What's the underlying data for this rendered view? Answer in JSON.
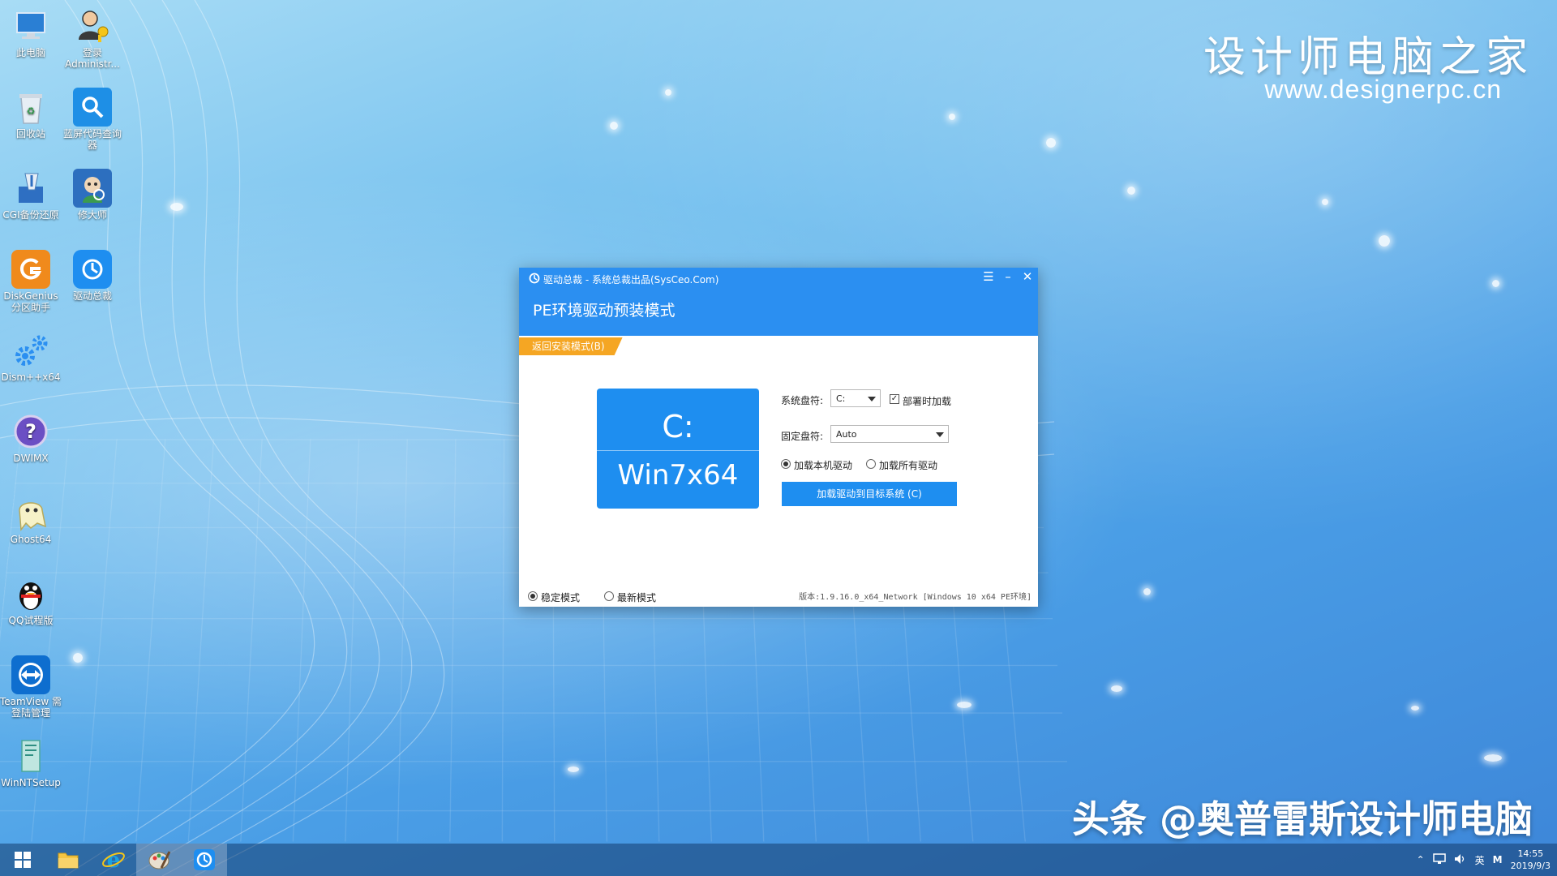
{
  "watermark": {
    "title": "设计师电脑之家",
    "url": "www.designerpc.cn",
    "bottom": "头条 @奥普雷斯设计师电脑"
  },
  "desktop_icons": [
    {
      "label": "此电脑",
      "icon": "computer-icon"
    },
    {
      "label": "登录 Administr...",
      "icon": "user-key-icon"
    },
    {
      "label": "回收站",
      "icon": "recycle-bin-icon"
    },
    {
      "label": "蓝屏代码查询器",
      "icon": "search-icon"
    },
    {
      "label": "CGI备份还原",
      "icon": "backup-tool-icon"
    },
    {
      "label": "修大师",
      "icon": "repair-icon"
    },
    {
      "label": "DiskGenius 分区助手",
      "icon": "diskgenius-icon"
    },
    {
      "label": "驱动总裁",
      "icon": "driver-icon"
    },
    {
      "label": "Dism++x64",
      "icon": "gears-icon"
    },
    {
      "label": "DWIMX",
      "icon": "help-icon"
    },
    {
      "label": "Ghost64",
      "icon": "ghost-icon"
    },
    {
      "label": "QQ试程版",
      "icon": "qq-penguin-icon"
    },
    {
      "label": "TeamView 需登陆管理",
      "icon": "teamviewer-icon"
    },
    {
      "label": "WinNTSetup",
      "icon": "setup-icon"
    }
  ],
  "window": {
    "title": "驱动总裁 - 系统总裁出品(SysCeo.Com)",
    "subtitle": "PE环境驱动预装模式",
    "back_tag": "返回安装模式(B)",
    "card_drive": "C:",
    "card_os": "Win7x64",
    "system_drive_label": "系统盘符:",
    "system_drive_value": "C:",
    "deploy_checkbox_label": "部署时加载",
    "deploy_checked": true,
    "fixed_drive_label": "固定盘符:",
    "fixed_drive_value": "Auto",
    "radio_local": "加载本机驱动",
    "radio_all": "加载所有驱动",
    "load_button": "加载驱动到目标系统 (C)",
    "mode_stable": "稳定模式",
    "mode_latest": "最新模式",
    "version": "版本:1.9.16.0_x64_Network [Windows 10 x64 PE环境]"
  },
  "taskbar": {
    "items": [
      "windows-start-icon",
      "file-explorer-icon",
      "internet-explorer-icon",
      "paint-icon",
      "driver-icon"
    ],
    "tray_lang": "英",
    "tray_m": "M",
    "time": "14:55",
    "date": "2019/9/3"
  },
  "colors": {
    "window_header": "#2b8ff1",
    "accent": "#1e8ef0",
    "tag": "#f5a623"
  }
}
